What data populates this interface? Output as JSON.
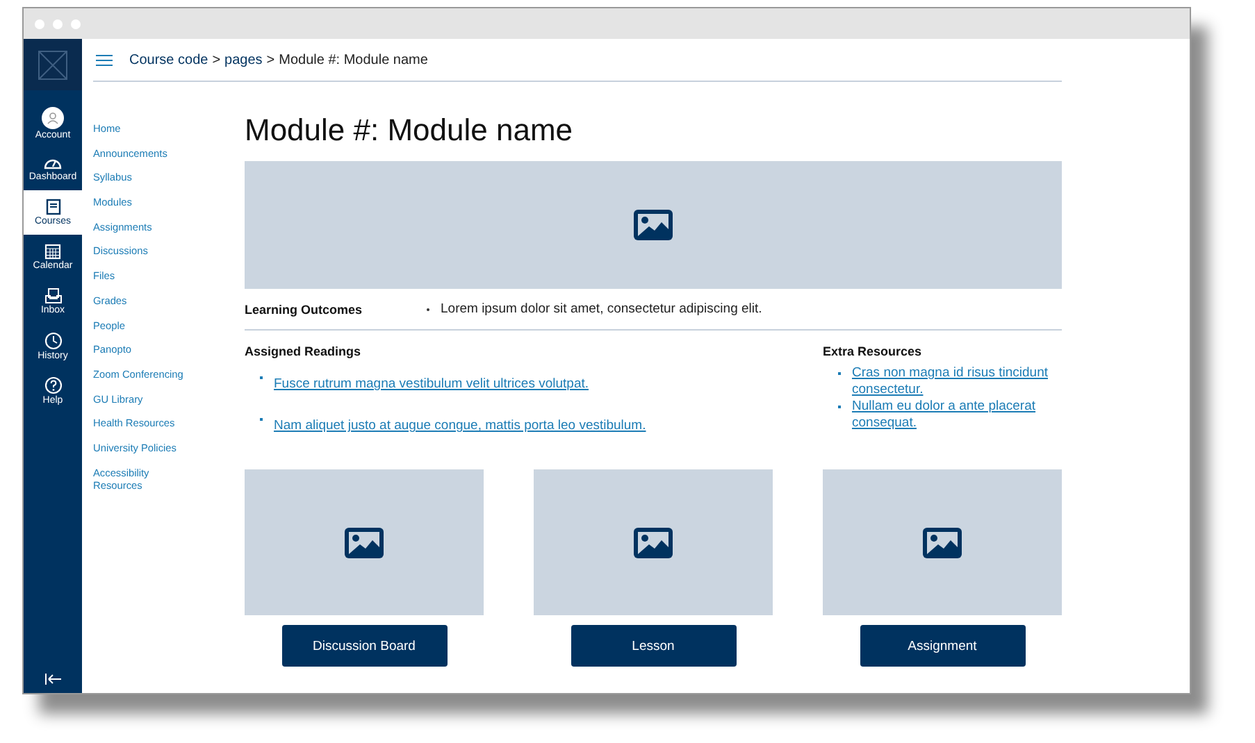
{
  "global_nav": [
    {
      "label": "Account",
      "kind": "account",
      "selected": false
    },
    {
      "label": "Dashboard",
      "kind": "dashboard",
      "selected": false
    },
    {
      "label": "Courses",
      "kind": "courses",
      "selected": true
    },
    {
      "label": "Calendar",
      "kind": "calendar",
      "selected": false
    },
    {
      "label": "Inbox",
      "kind": "inbox",
      "selected": false
    },
    {
      "label": "History",
      "kind": "history",
      "selected": false
    },
    {
      "label": "Help",
      "kind": "help",
      "selected": false
    }
  ],
  "breadcrumb": [
    {
      "label": "Course code",
      "kind": "link"
    },
    {
      "label": ">",
      "kind": "separator"
    },
    {
      "label": "pages",
      "kind": "link"
    },
    {
      "label": ">",
      "kind": "separator"
    },
    {
      "label": "Module #: Module name",
      "kind": "current"
    }
  ],
  "course_nav": [
    "Home",
    "Announcements",
    "Syllabus",
    "Modules",
    "Assignments",
    "Discussions",
    "Files",
    "Grades",
    "People",
    "Panopto",
    "Zoom Conferencing",
    "GU Library",
    "Health Resources",
    "University Policies",
    "Accessibility Resources"
  ],
  "page_title": "Module #: Module name",
  "learning_outcomes": {
    "heading": "Learning Outcomes",
    "items": [
      "Lorem ipsum dolor sit amet, consectetur adipiscing elit."
    ]
  },
  "assigned_readings": {
    "heading": "Assigned Readings",
    "links": [
      "Fusce rutrum magna vestibulum velit ultrices volutpat.",
      "Nam aliquet justo at augue congue, mattis porta leo vestibulum."
    ]
  },
  "extra_resources": {
    "heading": "Extra Resources",
    "links": [
      "Cras non magna id risus tincidunt consectetur.",
      "Nullam eu dolor a ante placerat consequat."
    ]
  },
  "cards": [
    {
      "button": "Discussion Board"
    },
    {
      "button": "Lesson"
    },
    {
      "button": "Assignment"
    }
  ]
}
